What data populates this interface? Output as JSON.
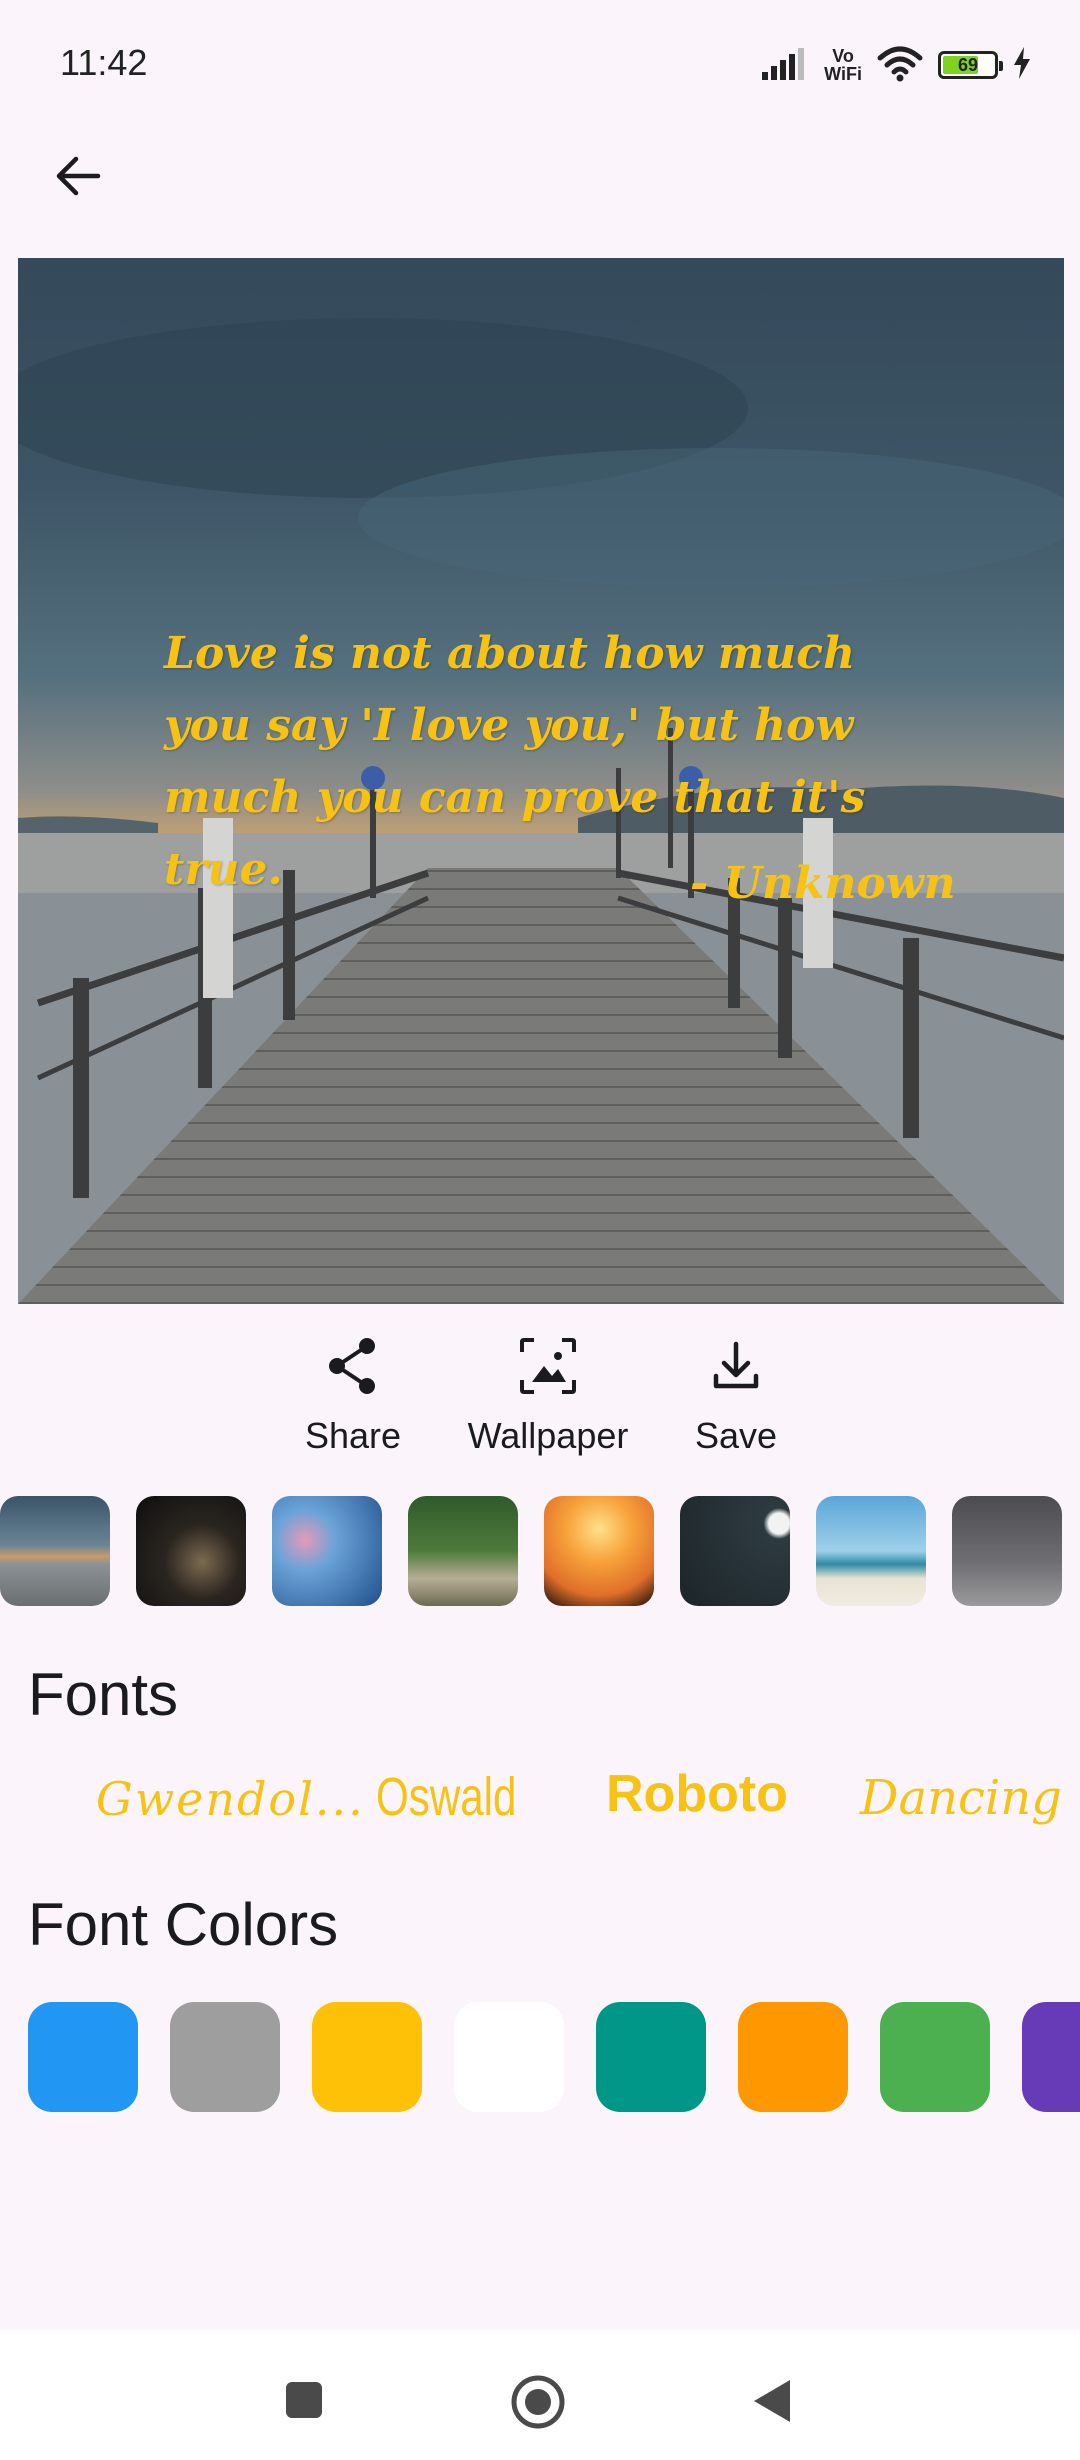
{
  "status_bar": {
    "time": "11:42",
    "vowifi_line1": "Vo",
    "vowifi_line2": "WiFi",
    "battery_level": 69,
    "battery_text": "69",
    "icons": [
      "signal-icon",
      "vowifi-icon",
      "wifi-icon",
      "battery-icon",
      "charging-icon"
    ]
  },
  "header": {
    "back_icon": "arrow-left-icon"
  },
  "quote": {
    "text": "Love is not about how much you say 'I love you,' but how much you can prove that it's true.",
    "author": "- Unknown",
    "color": "#f6c315"
  },
  "actions": [
    {
      "label": "Share",
      "icon": "share-icon"
    },
    {
      "label": "Wallpaper",
      "icon": "wallpaper-icon"
    },
    {
      "label": "Save",
      "icon": "download-icon"
    }
  ],
  "thumbnails": [
    "pier-sunset",
    "dark-book",
    "blue-bokeh",
    "forest-road",
    "cliff-jump-sunset",
    "dark-moon",
    "beach-sunglasses",
    "gray-clock"
  ],
  "fonts_section": {
    "title": "Fonts",
    "items": [
      "Gwendol...",
      "Oswald",
      "Roboto",
      "Dancing"
    ]
  },
  "font_colors_section": {
    "title": "Font Colors",
    "colors": [
      "#2196f3",
      "#9e9e9e",
      "#ffc107",
      "#ffffff",
      "#009688",
      "#ff9800",
      "#4caf50",
      "#673ab7"
    ]
  },
  "nav_bar": {
    "icons": [
      "recents-icon",
      "home-icon",
      "back-triangle-icon"
    ]
  }
}
